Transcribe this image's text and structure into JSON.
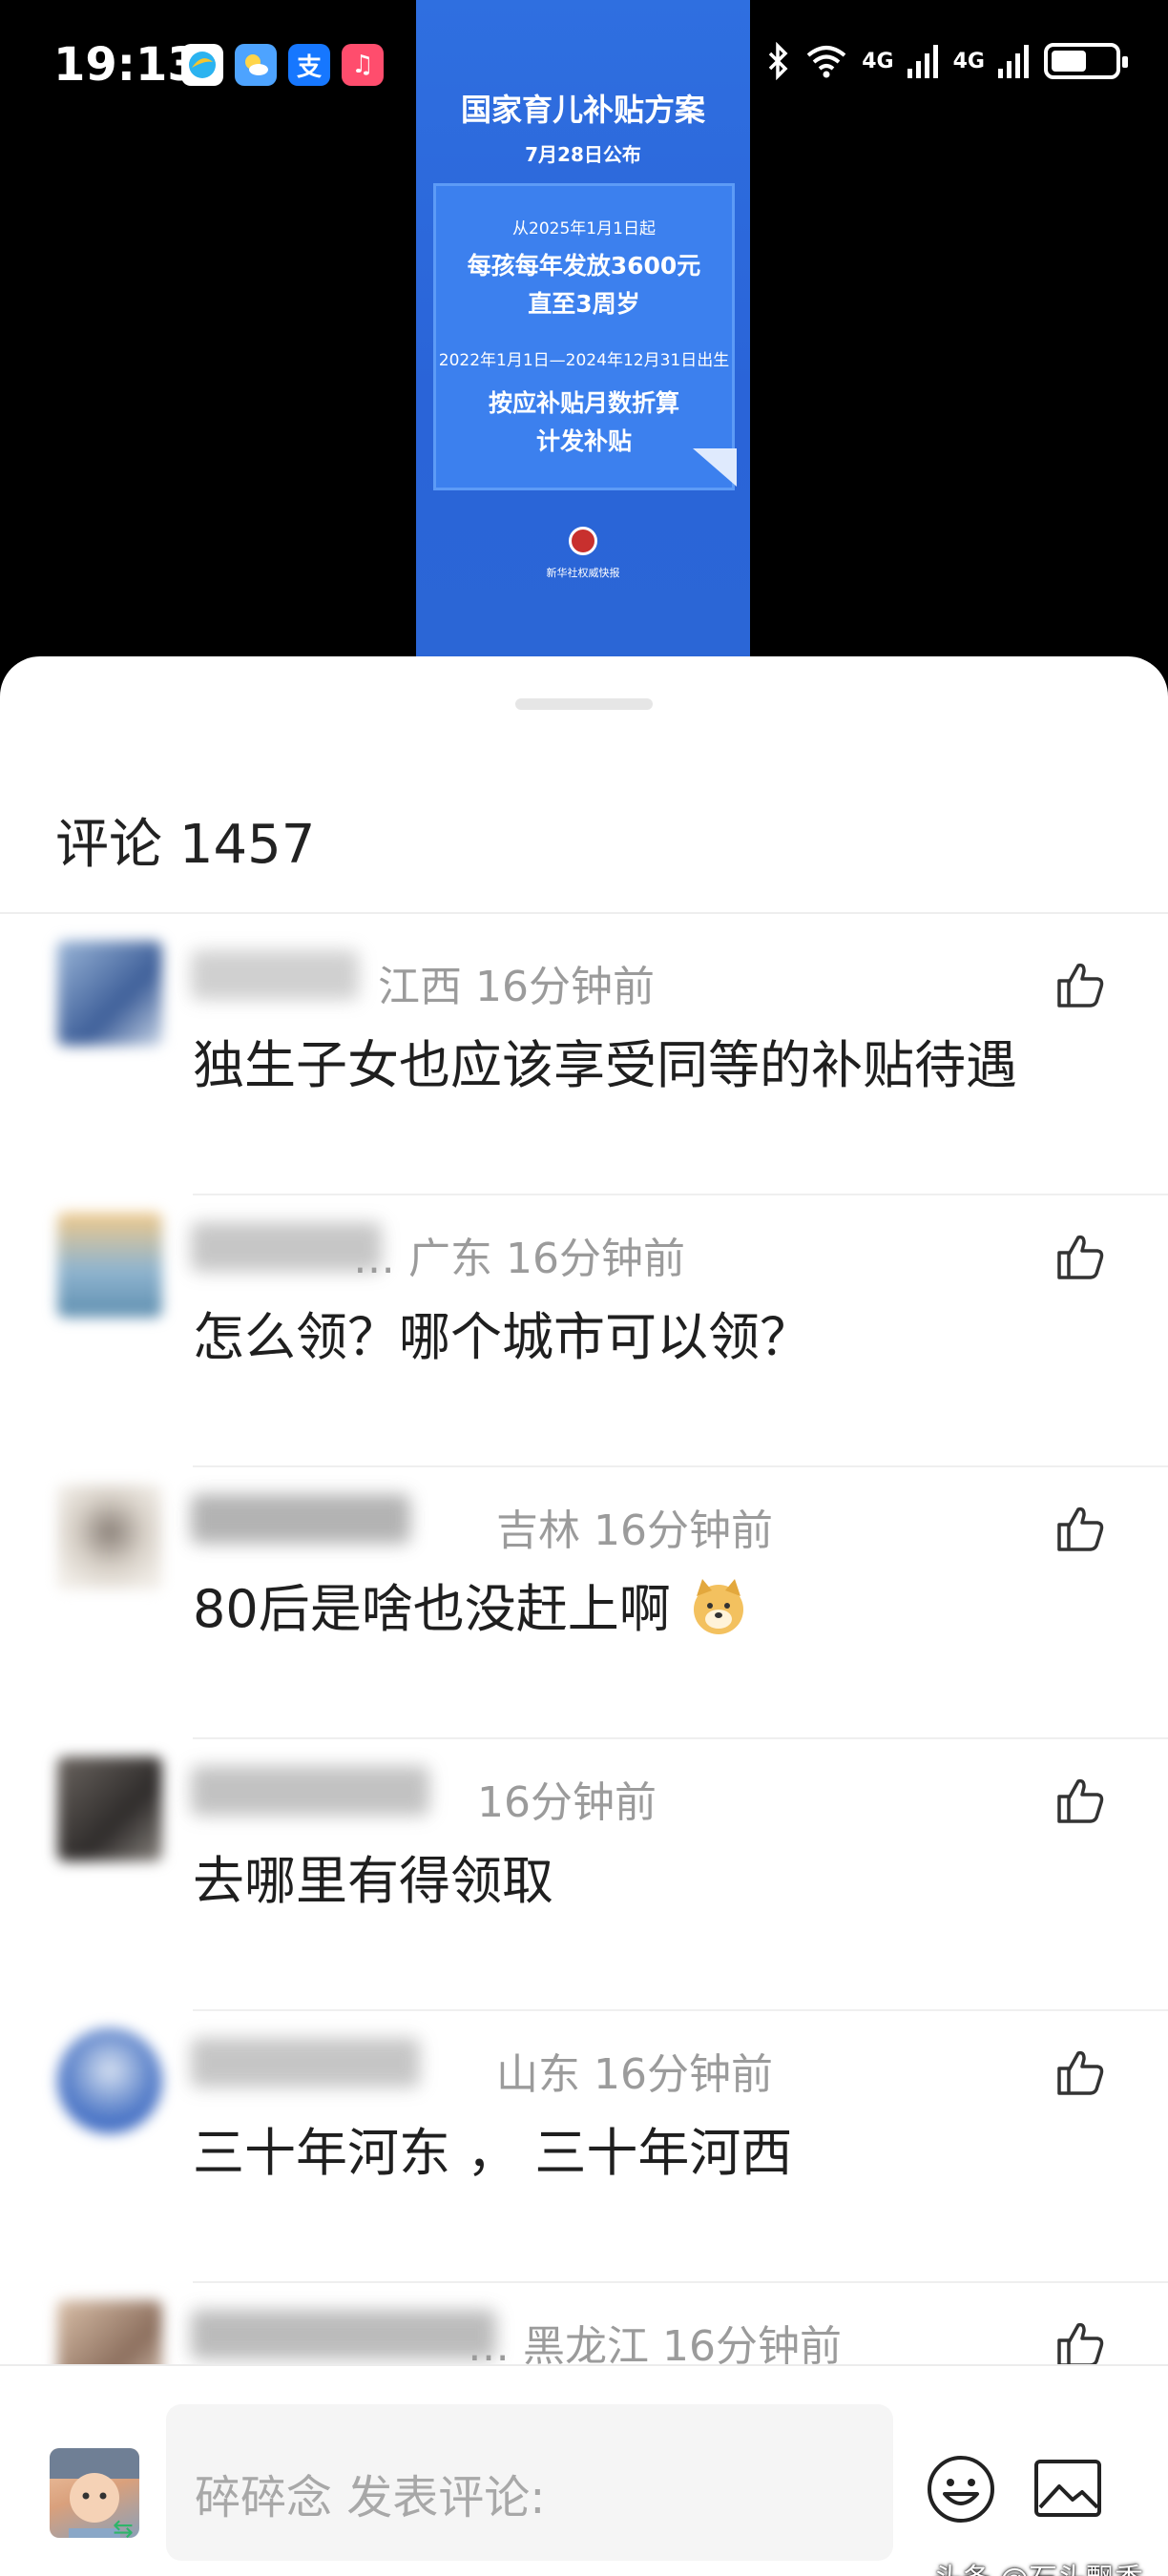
{
  "status_bar": {
    "time": "19:13",
    "network_1": "4G",
    "network_2": "4G",
    "app_icons": [
      "browser-icon",
      "weather-icon",
      "alipay-icon",
      "music-icon"
    ],
    "app_icon_3_glyph": "支",
    "app_icon_4_glyph": "♫"
  },
  "poster": {
    "title": "国家育儿补贴方案",
    "date": "7月28日公布",
    "line1": "从2025年1月1日起",
    "line2": "每孩每年发放3600元",
    "line3": "直至3周岁",
    "line4": "2022年1月1日—2024年12月31日出生",
    "line5": "按应补贴月数折算",
    "line6": "计发补贴",
    "credit": "新华社权威快报"
  },
  "comments_header": {
    "label": "评论",
    "count": "1457"
  },
  "comments": [
    {
      "region": "江西",
      "time": "16分钟前",
      "text": "独生子女也应该享受同等的补贴待遇",
      "avatar_color": "#5b7fb6",
      "name_width_hint": "wide"
    },
    {
      "name_visible": "…",
      "region": "广东",
      "time": "16分钟前",
      "text": "怎么领？哪个城市可以领？",
      "avatar_color": "#7fa8c9"
    },
    {
      "region": "吉林",
      "time": "16分钟前",
      "text": "80后是啥也没赶上啊",
      "avatar_color": "#c9c2b8",
      "has_emoji": true
    },
    {
      "region": "",
      "time": "16分钟前",
      "text": "去哪里有得领取",
      "avatar_color": "#4d4a48"
    },
    {
      "region": "山东",
      "time": "16分钟前",
      "text": "三十年河东 ， 三十年河西",
      "avatar_color": "#3d6fc9"
    },
    {
      "name_visible": "…",
      "region": "黑龙江",
      "time": "16分钟前",
      "text": "",
      "avatar_color": "#b79a86"
    }
  ],
  "input": {
    "placeholder": "碎碎念 发表评论:"
  },
  "watermark": "头条 @石头飘香",
  "colors": {
    "poster_blue": "#2f6fe0",
    "meta_gray": "#9b9b9b",
    "text": "#1f1f1f"
  }
}
